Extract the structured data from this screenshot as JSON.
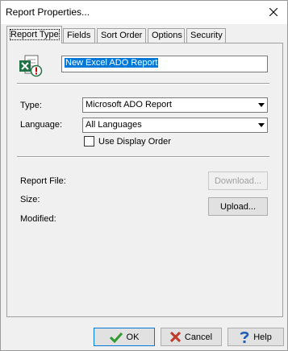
{
  "window": {
    "title": "Report Properties..."
  },
  "tabs": [
    {
      "label": "Report Type",
      "active": true
    },
    {
      "label": "Fields",
      "active": false
    },
    {
      "label": "Sort Order",
      "active": false
    },
    {
      "label": "Options",
      "active": false
    },
    {
      "label": "Security",
      "active": false
    }
  ],
  "report": {
    "icon": "excel-report-icon",
    "name_value": "New Excel ADO Report"
  },
  "fields": {
    "type_label": "Type:",
    "type_value": "Microsoft ADO Report",
    "language_label": "Language:",
    "language_value": "All Languages",
    "use_display_order_label": "Use Display Order",
    "use_display_order_checked": false
  },
  "file": {
    "report_file_label": "Report File:",
    "size_label": "Size:",
    "modified_label": "Modified:",
    "download_label": "Download...",
    "upload_label": "Upload..."
  },
  "footer": {
    "ok_label": "OK",
    "cancel_label": "Cancel",
    "help_label": "Help"
  },
  "colors": {
    "selection": "#0078d7",
    "excel_green": "#217346",
    "ok_check": "#2e9a2e",
    "cancel_x": "#c0392b",
    "help_blue": "#1e5fb4"
  }
}
